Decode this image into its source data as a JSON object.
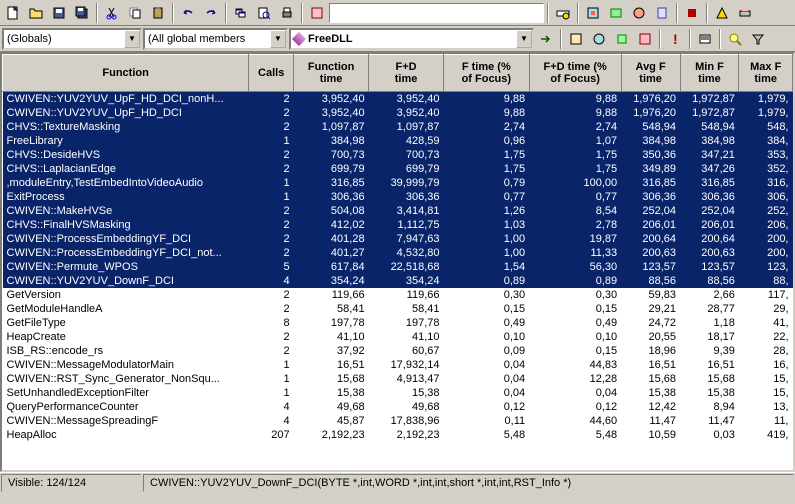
{
  "dropdowns": {
    "scope": "(Globals)",
    "members": "(All global members",
    "module": "FreeDLL"
  },
  "columns": [
    "Function",
    "Calls",
    "Function time",
    "F+D time",
    "F time (% of Focus)",
    "F+D time (% of Focus)",
    "Avg F time",
    "Min F time",
    "Max F time"
  ],
  "rows": [
    {
      "sel": true,
      "fn": "CWIVEN::YUV2YUV_UpF_HD_DCI_nonH...",
      "calls": "2",
      "ft": "3,952,40",
      "fdt": "3,952,40",
      "fp": "9,88",
      "fdp": "9,88",
      "avg": "1,976,20",
      "min": "1,972,87",
      "max": "1,979,"
    },
    {
      "sel": true,
      "fn": "CWIVEN::YUV2YUV_UpF_HD_DCI",
      "calls": "2",
      "ft": "3,952,40",
      "fdt": "3,952,40",
      "fp": "9,88",
      "fdp": "9,88",
      "avg": "1,976,20",
      "min": "1,972,87",
      "max": "1,979,"
    },
    {
      "sel": true,
      "fn": "CHVS::TextureMasking",
      "calls": "2",
      "ft": "1,097,87",
      "fdt": "1,097,87",
      "fp": "2,74",
      "fdp": "2,74",
      "avg": "548,94",
      "min": "548,94",
      "max": "548,"
    },
    {
      "sel": true,
      "fn": "FreeLibrary",
      "calls": "1",
      "ft": "384,98",
      "fdt": "428,59",
      "fp": "0,96",
      "fdp": "1,07",
      "avg": "384,98",
      "min": "384,98",
      "max": "384,"
    },
    {
      "sel": true,
      "fn": "CHVS::DesideHVS",
      "calls": "2",
      "ft": "700,73",
      "fdt": "700,73",
      "fp": "1,75",
      "fdp": "1,75",
      "avg": "350,36",
      "min": "347,21",
      "max": "353,"
    },
    {
      "sel": true,
      "fn": "CHVS::LaplacianEdge",
      "calls": "2",
      "ft": "699,79",
      "fdt": "699,79",
      "fp": "1,75",
      "fdp": "1,75",
      "avg": "349,89",
      "min": "347,26",
      "max": "352,"
    },
    {
      "sel": true,
      "fn": ",moduleEntry,TestEmbedIntoVideoAudio",
      "calls": "1",
      "ft": "316,85",
      "fdt": "39,999,79",
      "fp": "0,79",
      "fdp": "100,00",
      "avg": "316,85",
      "min": "316,85",
      "max": "316,"
    },
    {
      "sel": true,
      "fn": "ExitProcess",
      "calls": "1",
      "ft": "306,36",
      "fdt": "306,36",
      "fp": "0,77",
      "fdp": "0,77",
      "avg": "306,36",
      "min": "306,36",
      "max": "306,"
    },
    {
      "sel": true,
      "fn": "CWIVEN::MakeHVSe",
      "calls": "2",
      "ft": "504,08",
      "fdt": "3,414,81",
      "fp": "1,26",
      "fdp": "8,54",
      "avg": "252,04",
      "min": "252,04",
      "max": "252,"
    },
    {
      "sel": true,
      "fn": "CHVS::FinalHVSMasking",
      "calls": "2",
      "ft": "412,02",
      "fdt": "1,112,75",
      "fp": "1,03",
      "fdp": "2,78",
      "avg": "206,01",
      "min": "206,01",
      "max": "206,"
    },
    {
      "sel": true,
      "fn": "CWIVEN::ProcessEmbeddingYF_DCI",
      "calls": "2",
      "ft": "401,28",
      "fdt": "7,947,63",
      "fp": "1,00",
      "fdp": "19,87",
      "avg": "200,64",
      "min": "200,64",
      "max": "200,"
    },
    {
      "sel": true,
      "fn": "CWIVEN::ProcessEmbeddingYF_DCI_not...",
      "calls": "2",
      "ft": "401,27",
      "fdt": "4,532,80",
      "fp": "1,00",
      "fdp": "11,33",
      "avg": "200,63",
      "min": "200,63",
      "max": "200,"
    },
    {
      "sel": true,
      "fn": "CWIVEN::Permute_WPOS",
      "calls": "5",
      "ft": "617,84",
      "fdt": "22,518,68",
      "fp": "1,54",
      "fdp": "56,30",
      "avg": "123,57",
      "min": "123,57",
      "max": "123,"
    },
    {
      "sel": true,
      "fn": "CWIVEN::YUV2YUV_DownF_DCI",
      "calls": "4",
      "ft": "354,24",
      "fdt": "354,24",
      "fp": "0,89",
      "fdp": "0,89",
      "avg": "88,56",
      "min": "88,56",
      "max": "88,"
    },
    {
      "sel": false,
      "fn": "GetVersion",
      "calls": "2",
      "ft": "119,66",
      "fdt": "119,66",
      "fp": "0,30",
      "fdp": "0,30",
      "avg": "59,83",
      "min": "2,66",
      "max": "117,"
    },
    {
      "sel": false,
      "fn": "GetModuleHandleA",
      "calls": "2",
      "ft": "58,41",
      "fdt": "58,41",
      "fp": "0,15",
      "fdp": "0,15",
      "avg": "29,21",
      "min": "28,77",
      "max": "29,"
    },
    {
      "sel": false,
      "fn": "GetFileType",
      "calls": "8",
      "ft": "197,78",
      "fdt": "197,78",
      "fp": "0,49",
      "fdp": "0,49",
      "avg": "24,72",
      "min": "1,18",
      "max": "41,"
    },
    {
      "sel": false,
      "fn": "HeapCreate",
      "calls": "2",
      "ft": "41,10",
      "fdt": "41,10",
      "fp": "0,10",
      "fdp": "0,10",
      "avg": "20,55",
      "min": "18,17",
      "max": "22,"
    },
    {
      "sel": false,
      "fn": "ISB_RS::encode_rs",
      "calls": "2",
      "ft": "37,92",
      "fdt": "60,67",
      "fp": "0,09",
      "fdp": "0,15",
      "avg": "18,96",
      "min": "9,39",
      "max": "28,"
    },
    {
      "sel": false,
      "fn": "CWIVEN::MessageModulatorMain",
      "calls": "1",
      "ft": "16,51",
      "fdt": "17,932,14",
      "fp": "0,04",
      "fdp": "44,83",
      "avg": "16,51",
      "min": "16,51",
      "max": "16,"
    },
    {
      "sel": false,
      "fn": "CWIVEN::RST_Sync_Generator_NonSqu...",
      "calls": "1",
      "ft": "15,68",
      "fdt": "4,913,47",
      "fp": "0,04",
      "fdp": "12,28",
      "avg": "15,68",
      "min": "15,68",
      "max": "15,"
    },
    {
      "sel": false,
      "fn": "SetUnhandledExceptionFilter",
      "calls": "1",
      "ft": "15,38",
      "fdt": "15,38",
      "fp": "0,04",
      "fdp": "0,04",
      "avg": "15,38",
      "min": "15,38",
      "max": "15,"
    },
    {
      "sel": false,
      "fn": "QueryPerformanceCounter",
      "calls": "4",
      "ft": "49,68",
      "fdt": "49,68",
      "fp": "0,12",
      "fdp": "0,12",
      "avg": "12,42",
      "min": "8,94",
      "max": "13,"
    },
    {
      "sel": false,
      "fn": "CWIVEN::MessageSpreadingF",
      "calls": "4",
      "ft": "45,87",
      "fdt": "17,838,96",
      "fp": "0,11",
      "fdp": "44,60",
      "avg": "11,47",
      "min": "11,47",
      "max": "11,"
    },
    {
      "sel": false,
      "fn": "HeapAlloc",
      "calls": "207",
      "ft": "2,192,23",
      "fdt": "2,192,23",
      "fp": "5,48",
      "fdp": "5,48",
      "avg": "10,59",
      "min": "0,03",
      "max": "419,"
    }
  ],
  "status": {
    "visible": "Visible: 124/124",
    "signature": "CWIVEN::YUV2YUV_DownF_DCI(BYTE *,int,WORD *,int,int,short *,int,int,RST_Info *)"
  }
}
